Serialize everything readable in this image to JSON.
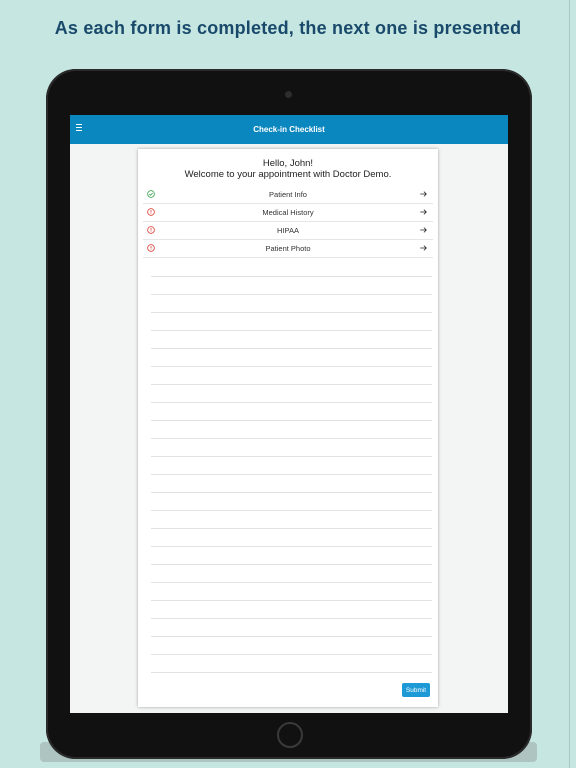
{
  "headline": "As each form is completed, the next one is presented",
  "app": {
    "title": "Check-in Checklist",
    "menu_icon": "hamburger-icon"
  },
  "card": {
    "greeting": "Hello, John!",
    "welcome": "Welcome to your appointment with Doctor Demo."
  },
  "checklist": [
    {
      "label": "Patient Info",
      "status": "complete",
      "status_icon": "check-circle-icon",
      "status_color": "#2e9e44",
      "action_icon": "arrow-right-icon"
    },
    {
      "label": "Medical History",
      "status": "incomplete",
      "status_icon": "alert-circle-icon",
      "status_color": "#d9372b",
      "action_icon": "arrow-right-icon"
    },
    {
      "label": "HIPAA",
      "status": "incomplete",
      "status_icon": "alert-circle-icon",
      "status_color": "#d9372b",
      "action_icon": "arrow-right-icon"
    },
    {
      "label": "Patient Photo",
      "status": "incomplete",
      "status_icon": "alert-circle-icon",
      "status_color": "#d9372b",
      "action_icon": "arrow-right-icon"
    }
  ],
  "submit_label": "Submit",
  "colors": {
    "background": "#c6e6e1",
    "headline": "#1a4a6b",
    "header": "#0b87c0",
    "submit": "#1d9ad6",
    "complete": "#2e9e44",
    "incomplete": "#d9372b"
  }
}
